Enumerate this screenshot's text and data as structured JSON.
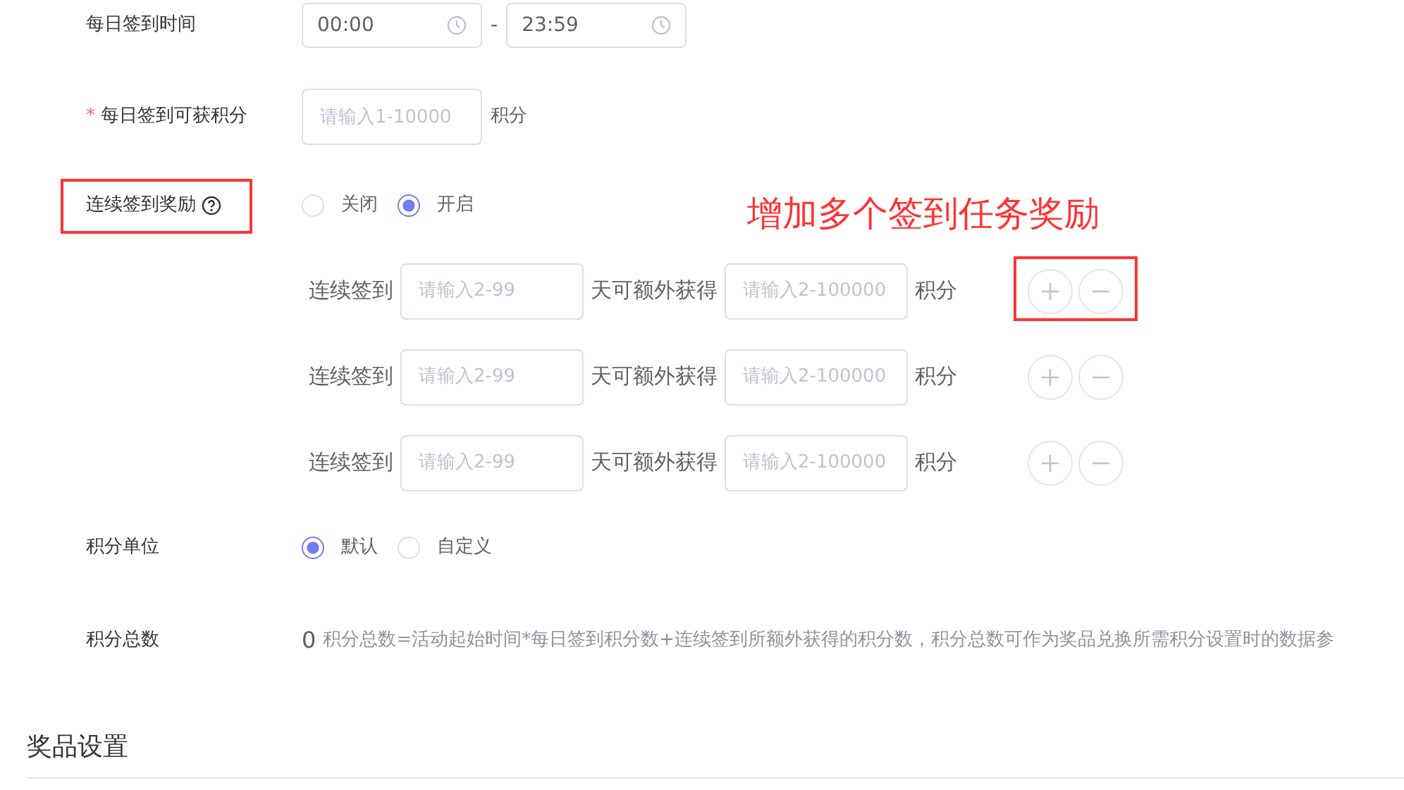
{
  "fields": [
    {
      "kind": "time_range",
      "label": "每日签到时间",
      "start": "00:00",
      "separator": "-",
      "end": "23:59"
    },
    {
      "kind": "number",
      "label": "每日签到可获积分",
      "required_mark": "*",
      "placeholder": "请输入1-10000",
      "unit": "积分"
    },
    {
      "kind": "radio",
      "label": "连续签到奖励",
      "help": true,
      "highlighted": true,
      "options": [
        {
          "label": "关闭",
          "selected": false
        },
        {
          "label": "开启",
          "selected": true
        }
      ]
    },
    {
      "kind": "rules",
      "rows": [
        {
          "prefix": "连续签到",
          "days_placeholder": "请输入2-99",
          "middle": "天可额外获得",
          "points_placeholder": "请输入2-100000",
          "unit": "积分",
          "highlighted": true
        },
        {
          "prefix": "连续签到",
          "days_placeholder": "请输入2-99",
          "middle": "天可额外获得",
          "points_placeholder": "请输入2-100000",
          "unit": "积分"
        },
        {
          "prefix": "连续签到",
          "days_placeholder": "请输入2-99",
          "middle": "天可额外获得",
          "points_placeholder": "请输入2-100000",
          "unit": "积分"
        }
      ]
    },
    {
      "kind": "radio",
      "label": "积分单位",
      "options": [
        {
          "label": "默认",
          "selected": true
        },
        {
          "label": "自定义",
          "selected": false
        }
      ]
    },
    {
      "kind": "total",
      "label": "积分总数",
      "value": "0",
      "note": "积分总数=活动起始时间*每日签到积分数+连续签到所额外获得的积分数，积分总数可作为奖品兑换所需积分设置时的数据参"
    }
  ],
  "annotation": "增加多个签到任务奖励",
  "section_title": "奖品设置"
}
